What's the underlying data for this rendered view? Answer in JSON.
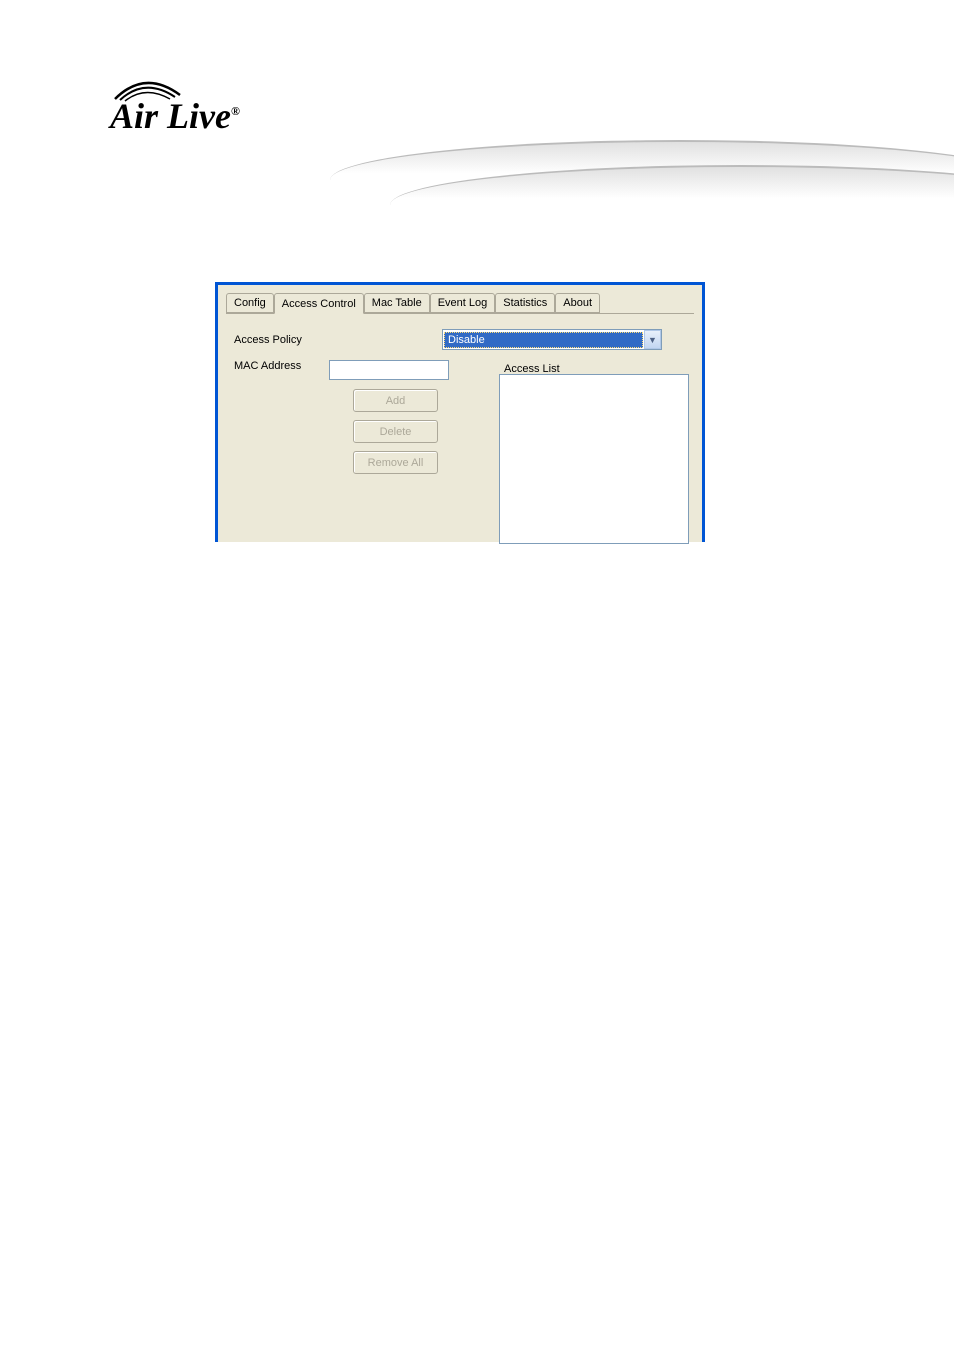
{
  "logo": {
    "text": "Air Live",
    "trademark": "®"
  },
  "tabs": [
    {
      "label": "Config",
      "active": false
    },
    {
      "label": "Access Control",
      "active": true
    },
    {
      "label": "Mac Table",
      "active": false
    },
    {
      "label": "Event Log",
      "active": false
    },
    {
      "label": "Statistics",
      "active": false
    },
    {
      "label": "About",
      "active": false
    }
  ],
  "form": {
    "access_policy_label": "Access Policy",
    "access_policy_value": "Disable",
    "mac_address_label": "MAC Address",
    "mac_address_value": "",
    "access_list_label": "Access List"
  },
  "buttons": {
    "add": "Add",
    "delete": "Delete",
    "remove_all": "Remove All"
  }
}
